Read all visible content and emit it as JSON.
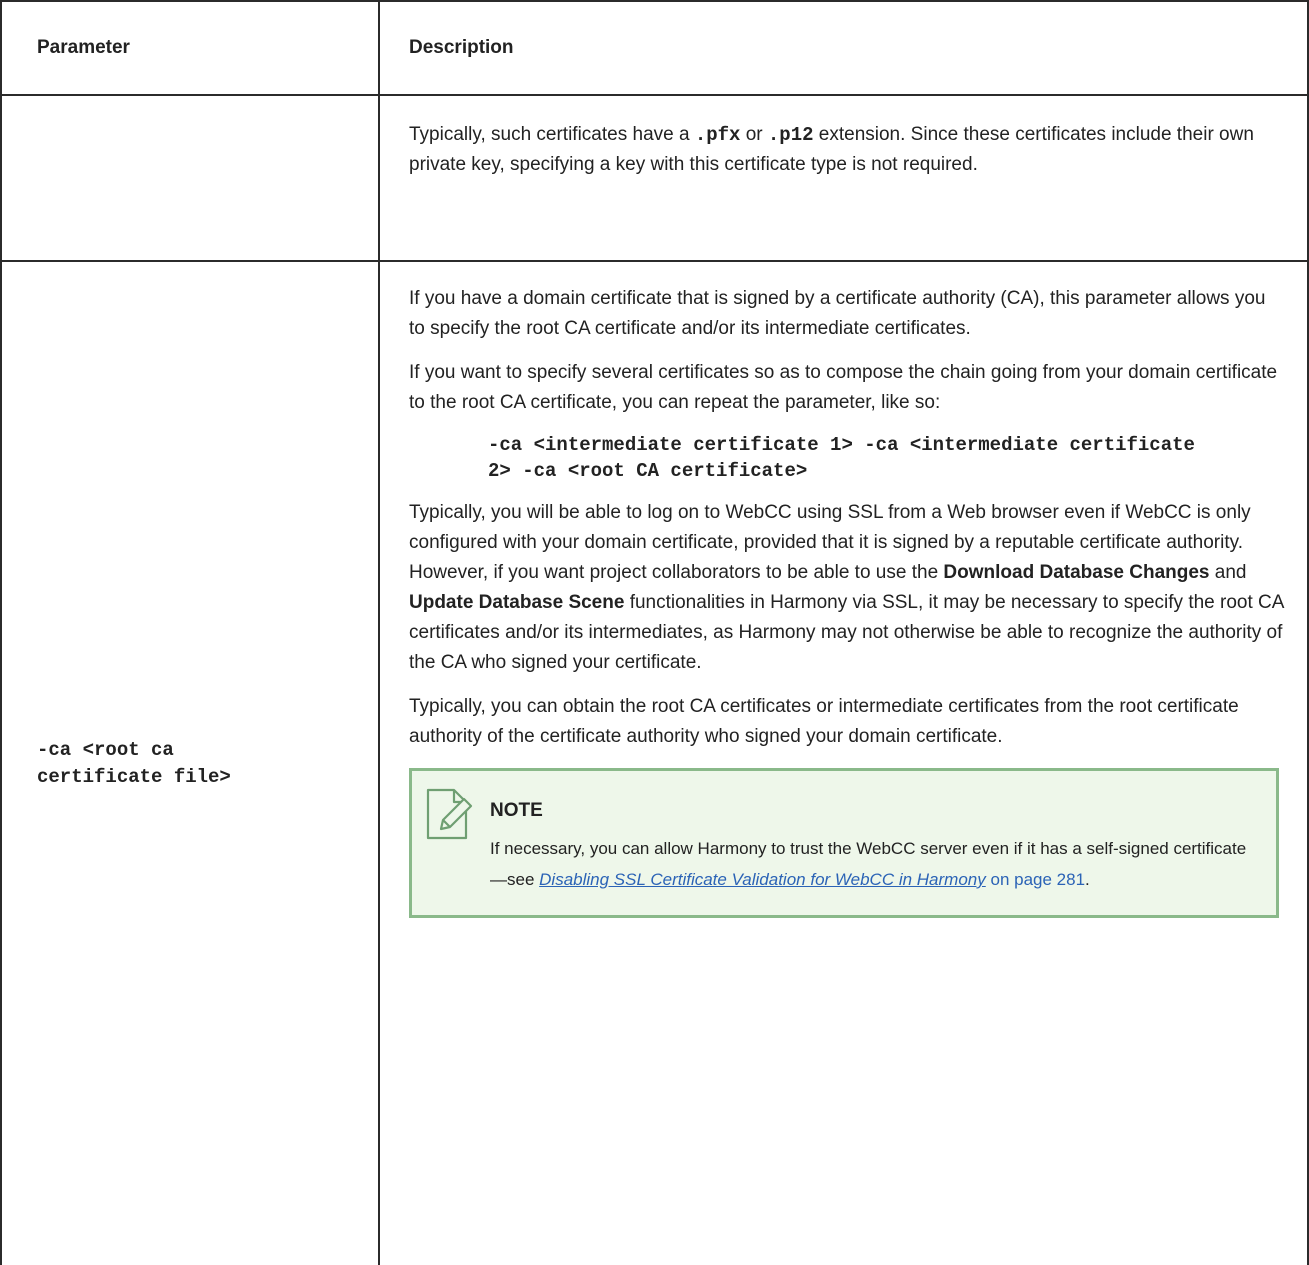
{
  "table": {
    "headers": {
      "parameter": "Parameter",
      "description": "Description"
    },
    "row1": {
      "parameter": "",
      "desc": {
        "p1_before": "Typically, such certificates have a ",
        "ext1": ".pfx",
        "p1_or": " or ",
        "ext2": ".p12",
        "p1_after": " extension. Since these certificates include their own private key, specifying a key with this certificate type is not required."
      }
    },
    "row2": {
      "parameter": "-ca <root ca certificate file>",
      "desc": {
        "p1": "If you have a domain certificate that is signed by a certificate authority (CA), this parameter allows you to specify the root CA certificate and/or its intermediate certificates.",
        "p2": "If you want to specify several certificates so as to compose the chain going from your domain certificate to the root CA certificate, you can repeat the parameter, like so:",
        "code": "-ca <intermediate certificate 1> -ca <intermediate certificate 2> -ca <root CA certificate>",
        "p3_a": "Typically, you will be able to log on to WebCC using SSL from a Web browser even if WebCC is only configured with your domain certificate, provided that it is signed by a reputable certificate authority. However, if you want project collaborators to be able to use the ",
        "p3_bold1": "Download Database Changes",
        "p3_b": " and ",
        "p3_bold2": "Update Database Scene",
        "p3_c": " functionalities in Harmony via SSL, it may be necessary to specify the root CA certificates and/or its intermediates, as Harmony may not otherwise be able to recognize the authority of the CA who signed your certificate.",
        "p4": "Typically, you can obtain the root CA certificates or intermediate certificates from the root certificate authority of the certificate authority who signed your domain certificate."
      },
      "note": {
        "icon": "note-pencil-icon",
        "title": "NOTE",
        "body_before": "If necessary, you can allow Harmony to trust the WebCC server even if it has a self-signed certificate—see ",
        "link_text": "Disabling SSL Certificate Validation for WebCC in Harmony",
        "page_ref": "on page 281",
        "body_after": "."
      }
    }
  },
  "colors": {
    "note_background": "#eef7ea",
    "note_border": "#8ab98a",
    "link": "#2b63b6",
    "table_border": "#2b2b2b"
  }
}
